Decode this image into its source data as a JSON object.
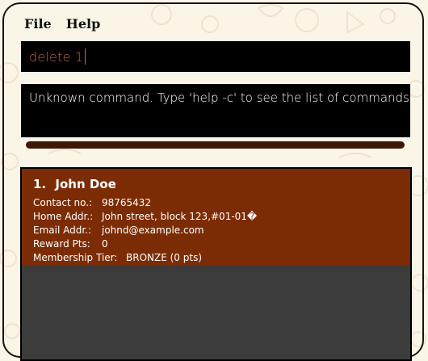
{
  "menu": {
    "file": "File",
    "help": "Help"
  },
  "command_box": {
    "value": "delete 1"
  },
  "result_display": {
    "text": "Unknown command. Type 'help -c' to see the list of commands."
  },
  "customers": [
    {
      "index": "1.",
      "name": "John Doe",
      "contact_label": "Contact no.:",
      "contact": "98765432",
      "address_label": "Home Addr.:",
      "address": "John street, block 123,#01-01�",
      "email_label": "Email Addr.:",
      "email": "johnd@example.com",
      "reward_label": "Reward Pts:",
      "reward": "0",
      "tier_label": "Membership Tier:",
      "tier": "BRONZE (0 pts)"
    }
  ],
  "colors": {
    "card": "#7c2c04",
    "command_text": "#c2644d",
    "splitter": "#3e1806"
  }
}
